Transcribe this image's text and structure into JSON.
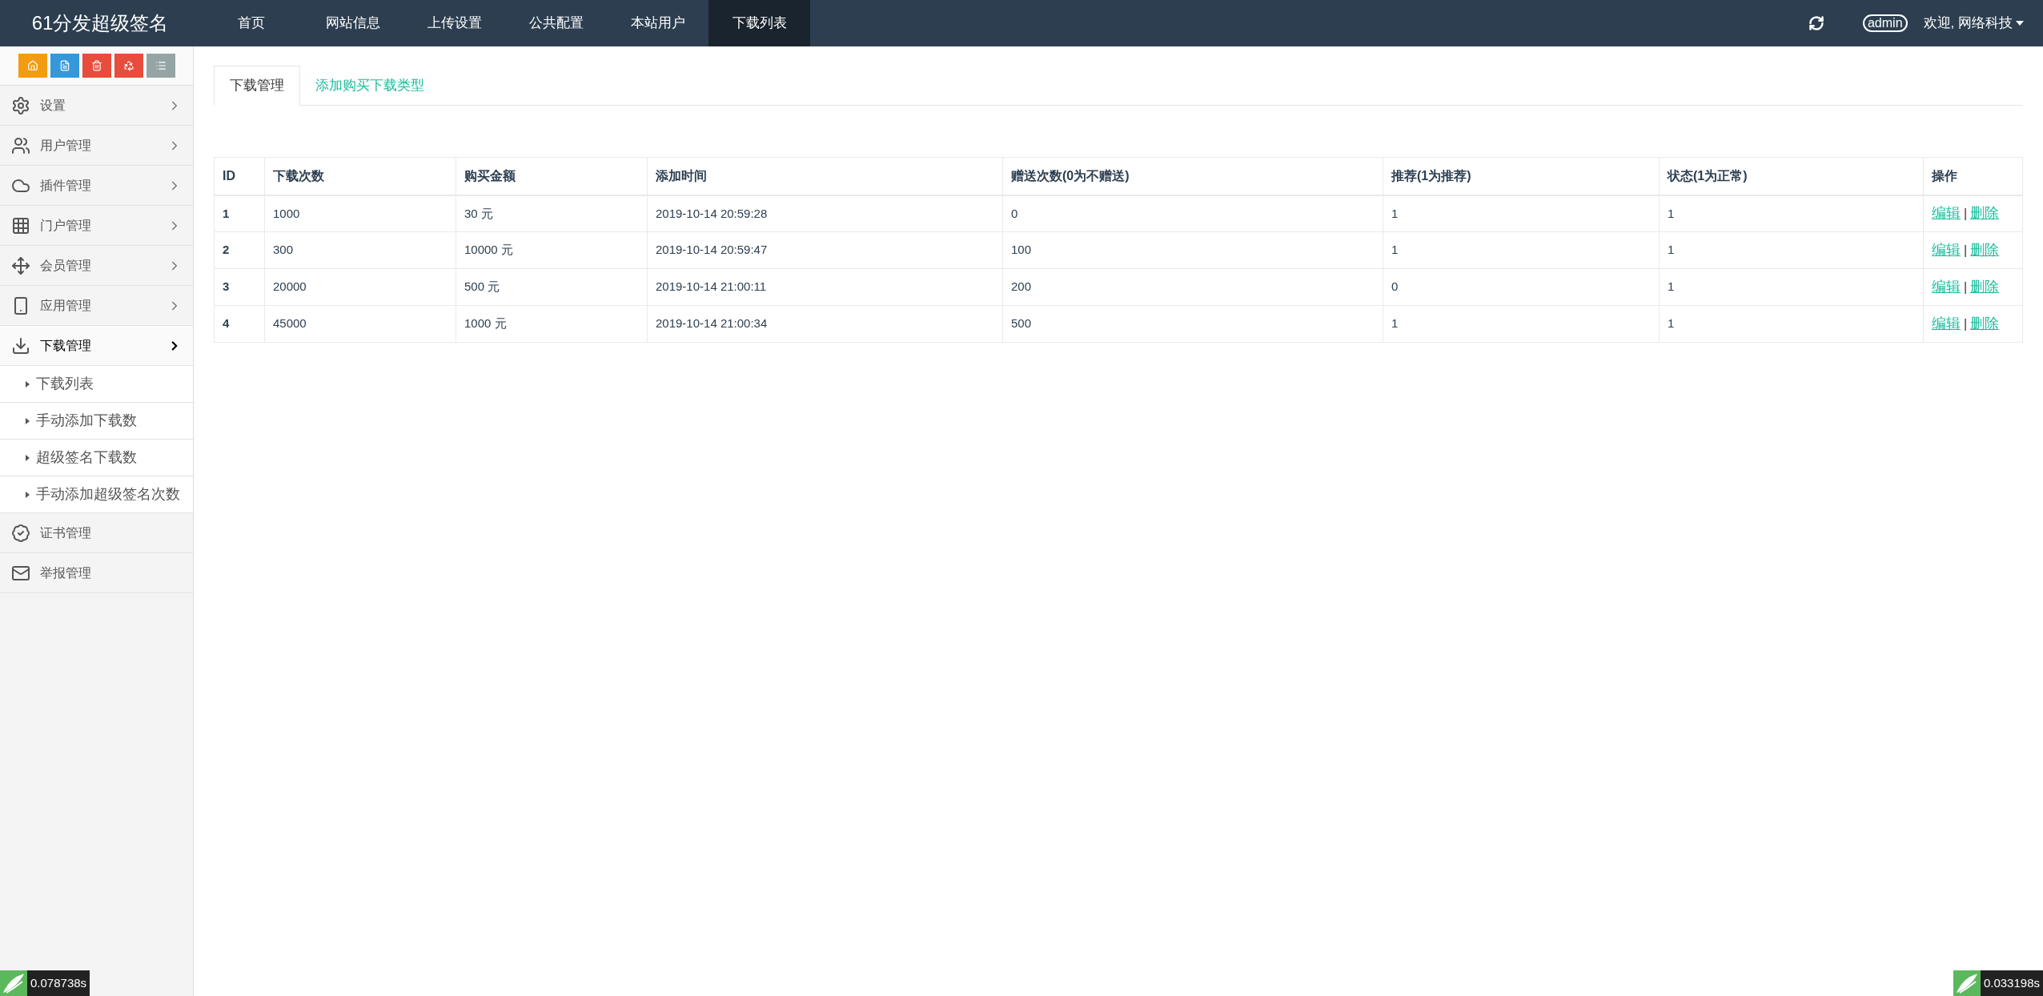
{
  "brand": "61分发超级签名",
  "nav": [
    {
      "label": "首页",
      "selected": false
    },
    {
      "label": "网站信息",
      "selected": false
    },
    {
      "label": "上传设置",
      "selected": false
    },
    {
      "label": "公共配置",
      "selected": false
    },
    {
      "label": "本站用户",
      "selected": false
    },
    {
      "label": "下载列表",
      "selected": true
    }
  ],
  "user": {
    "badge": "admin",
    "greeting": "欢迎, 网络科技"
  },
  "quick_buttons": [
    {
      "kind": "home",
      "color": "#f39c12"
    },
    {
      "kind": "file",
      "color": "#3498db"
    },
    {
      "kind": "trash",
      "color": "#e74c3c"
    },
    {
      "kind": "recycle",
      "color": "#e74c3c"
    },
    {
      "kind": "list",
      "color": "#95a5a6"
    }
  ],
  "sidebar": [
    {
      "label": "设置",
      "kind": "group",
      "expanded": false
    },
    {
      "label": "用户管理",
      "kind": "group",
      "expanded": false
    },
    {
      "label": "插件管理",
      "kind": "group",
      "expanded": false
    },
    {
      "label": "门户管理",
      "kind": "group",
      "expanded": false
    },
    {
      "label": "会员管理",
      "kind": "group",
      "expanded": false
    },
    {
      "label": "应用管理",
      "kind": "group",
      "expanded": false
    },
    {
      "label": "下载管理",
      "kind": "group",
      "expanded": true,
      "children": [
        {
          "label": "下载列表"
        },
        {
          "label": "手动添加下载数"
        },
        {
          "label": "超级签名下载数"
        },
        {
          "label": "手动添加超级签名次数"
        }
      ]
    },
    {
      "label": "证书管理",
      "kind": "link",
      "expanded": false
    },
    {
      "label": "举报管理",
      "kind": "link",
      "expanded": false
    }
  ],
  "tabs": [
    {
      "label": "下载管理",
      "selected": true
    },
    {
      "label": "添加购买下载类型",
      "selected": false
    }
  ],
  "table": {
    "columns": [
      "ID",
      "下载次数",
      "购买金额",
      "添加时间",
      "赠送次数(0为不赠送)",
      "推荐(1为推荐)",
      "状态(1为正常)",
      "操作"
    ],
    "rows": [
      {
        "cells": [
          "1",
          "1000",
          "30 元",
          "2019-10-14 20:59:28",
          "0",
          "1",
          "1"
        ],
        "actions": [
          "编辑",
          "删除"
        ],
        "separator": "|"
      },
      {
        "cells": [
          "2",
          "300",
          "10000 元",
          "2019-10-14 20:59:47",
          "100",
          "1",
          "1"
        ],
        "actions": [
          "编辑",
          "删除"
        ],
        "separator": "|"
      },
      {
        "cells": [
          "3",
          "20000",
          "500 元",
          "2019-10-14 21:00:11",
          "200",
          "0",
          "1"
        ],
        "actions": [
          "编辑",
          "删除"
        ],
        "separator": "|"
      },
      {
        "cells": [
          "4",
          "45000",
          "1000 元",
          "2019-10-14 21:00:34",
          "500",
          "1",
          "1"
        ],
        "actions": [
          "编辑",
          "删除"
        ],
        "separator": "|"
      }
    ]
  },
  "timers": [
    "0.078738s",
    "0.033198s"
  ]
}
